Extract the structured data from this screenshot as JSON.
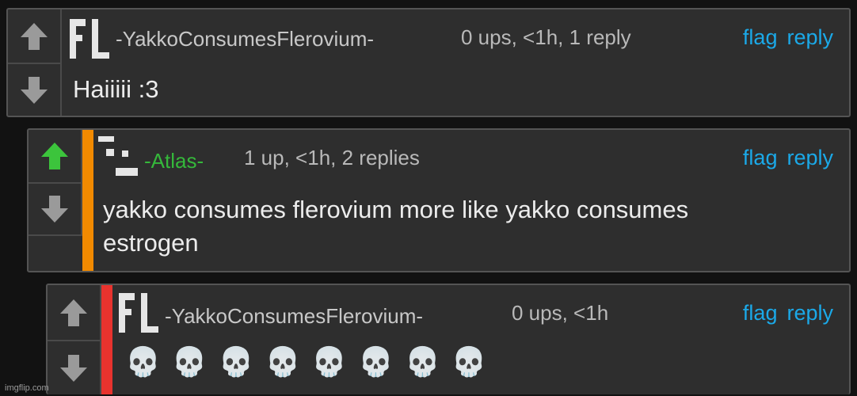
{
  "comments": [
    {
      "username": "-YakkoConsumesFlerovium-",
      "username_color": "#c8c8c8",
      "meta": "0 ups, <1h, 1 reply",
      "flag": "flag",
      "reply": "reply",
      "text": "Haiiiii :3",
      "upvoted": false
    },
    {
      "username": "-Atlas-",
      "username_color": "#35b83b",
      "bar_color": "#f28a00",
      "meta": "1 up, <1h, 2 replies",
      "flag": "flag",
      "reply": "reply",
      "text_line1": "yakko consumes flerovium more like yakko consumes",
      "text_line2": "estrogen",
      "upvoted": true
    },
    {
      "username": "-YakkoConsumesFlerovium-",
      "username_color": "#c8c8c8",
      "bar_color": "#e8332e",
      "meta": "0 ups, <1h",
      "flag": "flag",
      "reply": "reply",
      "skulls": [
        "💀",
        "💀",
        "💀",
        "💀",
        "💀",
        "💀",
        "💀",
        "💀"
      ],
      "upvoted": false
    }
  ],
  "icons": {
    "up_arrow": "up-arrow-icon",
    "down_arrow": "down-arrow-icon",
    "skull": "skull-icon"
  },
  "colors": {
    "upvote_active": "#3cc43c",
    "arrow_inactive": "#9a9a9a",
    "link": "#1ba9e8"
  },
  "watermark": "imgflip.com"
}
